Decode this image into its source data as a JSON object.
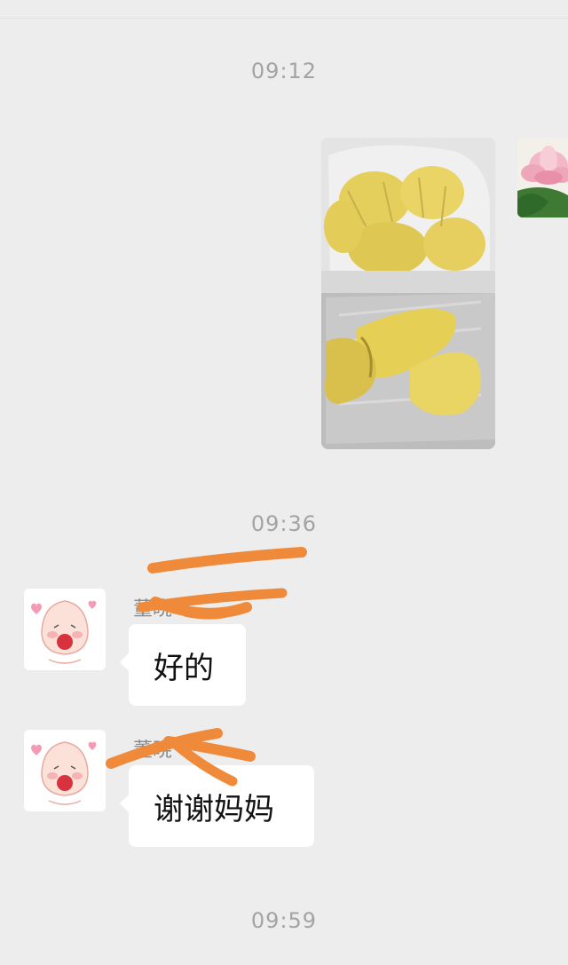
{
  "timestamps": [
    "09:12",
    "09:36",
    "09:59"
  ],
  "sent_photo": {
    "content": "photo of peeled durian pieces in plastic container"
  },
  "messages": [
    {
      "sender_name": "董晓",
      "text": "好的"
    },
    {
      "sender_name": "董晓",
      "text": "谢谢妈妈"
    }
  ],
  "colors": {
    "background": "#ededed",
    "bubble": "#ffffff",
    "timestamp": "#a3a3a3",
    "scribble": "#ef8a3a"
  }
}
